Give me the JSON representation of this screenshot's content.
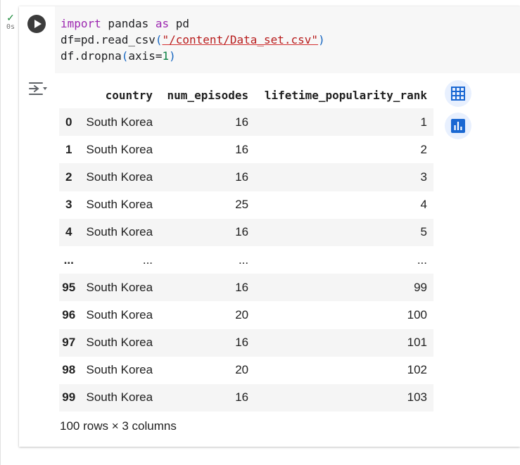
{
  "cell": {
    "status": {
      "check": "✓",
      "time": "0s"
    },
    "code_lines": [
      [
        {
          "t": "import",
          "c": "kw"
        },
        {
          "t": " pandas ",
          "c": ""
        },
        {
          "t": "as",
          "c": "kw"
        },
        {
          "t": " pd",
          "c": ""
        }
      ],
      [
        {
          "t": "df=pd.read_csv",
          "c": ""
        },
        {
          "t": "(",
          "c": "paren"
        },
        {
          "t": "\"/content/Data_set.csv\"",
          "c": "str"
        },
        {
          "t": ")",
          "c": "paren"
        }
      ],
      [
        {
          "t": "df.dropna",
          "c": ""
        },
        {
          "t": "(",
          "c": "paren"
        },
        {
          "t": "axis=",
          "c": ""
        },
        {
          "t": "1",
          "c": "num"
        },
        {
          "t": ")",
          "c": "paren"
        }
      ]
    ]
  },
  "output": {
    "columns": [
      "country",
      "num_episodes",
      "lifetime_popularity_rank"
    ],
    "rows": [
      {
        "idx": "0",
        "country": "South Korea",
        "eps": "16",
        "rank": "1"
      },
      {
        "idx": "1",
        "country": "South Korea",
        "eps": "16",
        "rank": "2"
      },
      {
        "idx": "2",
        "country": "South Korea",
        "eps": "16",
        "rank": "3"
      },
      {
        "idx": "3",
        "country": "South Korea",
        "eps": "25",
        "rank": "4"
      },
      {
        "idx": "4",
        "country": "South Korea",
        "eps": "16",
        "rank": "5"
      },
      {
        "idx": "...",
        "country": "...",
        "eps": "...",
        "rank": "...",
        "ellipsis": true
      },
      {
        "idx": "95",
        "country": "South Korea",
        "eps": "16",
        "rank": "99"
      },
      {
        "idx": "96",
        "country": "South Korea",
        "eps": "20",
        "rank": "100"
      },
      {
        "idx": "97",
        "country": "South Korea",
        "eps": "16",
        "rank": "101"
      },
      {
        "idx": "98",
        "country": "South Korea",
        "eps": "20",
        "rank": "102"
      },
      {
        "idx": "99",
        "country": "South Korea",
        "eps": "16",
        "rank": "103"
      }
    ],
    "shape_label": "100 rows × 3 columns"
  },
  "icons": {
    "run": "play-icon",
    "output_menu": "output-actions-icon",
    "table": "table-icon",
    "chart": "bar-chart-icon"
  },
  "colors": {
    "accent": "#1967d2",
    "action_bg": "#e8f0fe",
    "success": "#1a8a3a"
  }
}
